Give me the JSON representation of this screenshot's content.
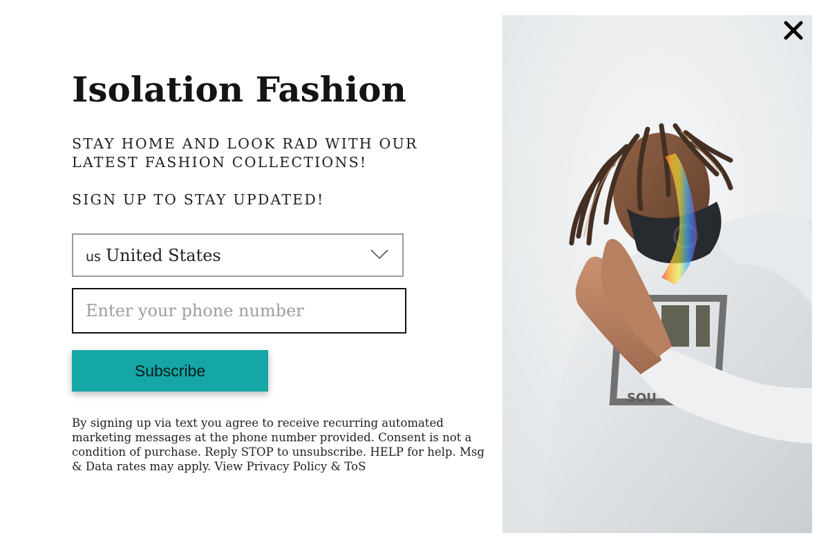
{
  "popup": {
    "title": "Isolation Fashion",
    "tagline": "STAY HOME AND LOOK RAD WITH OUR LATEST FASHION COLLECTIONS!",
    "signup_text": "SIGN UP TO STAY UPDATED!",
    "country_select": {
      "code": "us",
      "selected": "United States"
    },
    "phone_input": {
      "value": "",
      "placeholder": "Enter your phone number"
    },
    "subscribe_label": "Subscribe",
    "legal_text": "By signing up via text you agree to receive recurring automated marketing messages at the phone number provided. Consent is not a condition of purchase. Reply STOP to unsubscribe. HELP for help. Msg & Data rates may apply. ",
    "legal_links": {
      "view": "View",
      "privacy": "Privacy Policy",
      "amp": "&",
      "tos": "ToS"
    },
    "close_icon": "close-icon",
    "colors": {
      "accent": "#15a6a6",
      "text": "#1f1f1f",
      "placeholder": "#9e9e9e"
    }
  }
}
